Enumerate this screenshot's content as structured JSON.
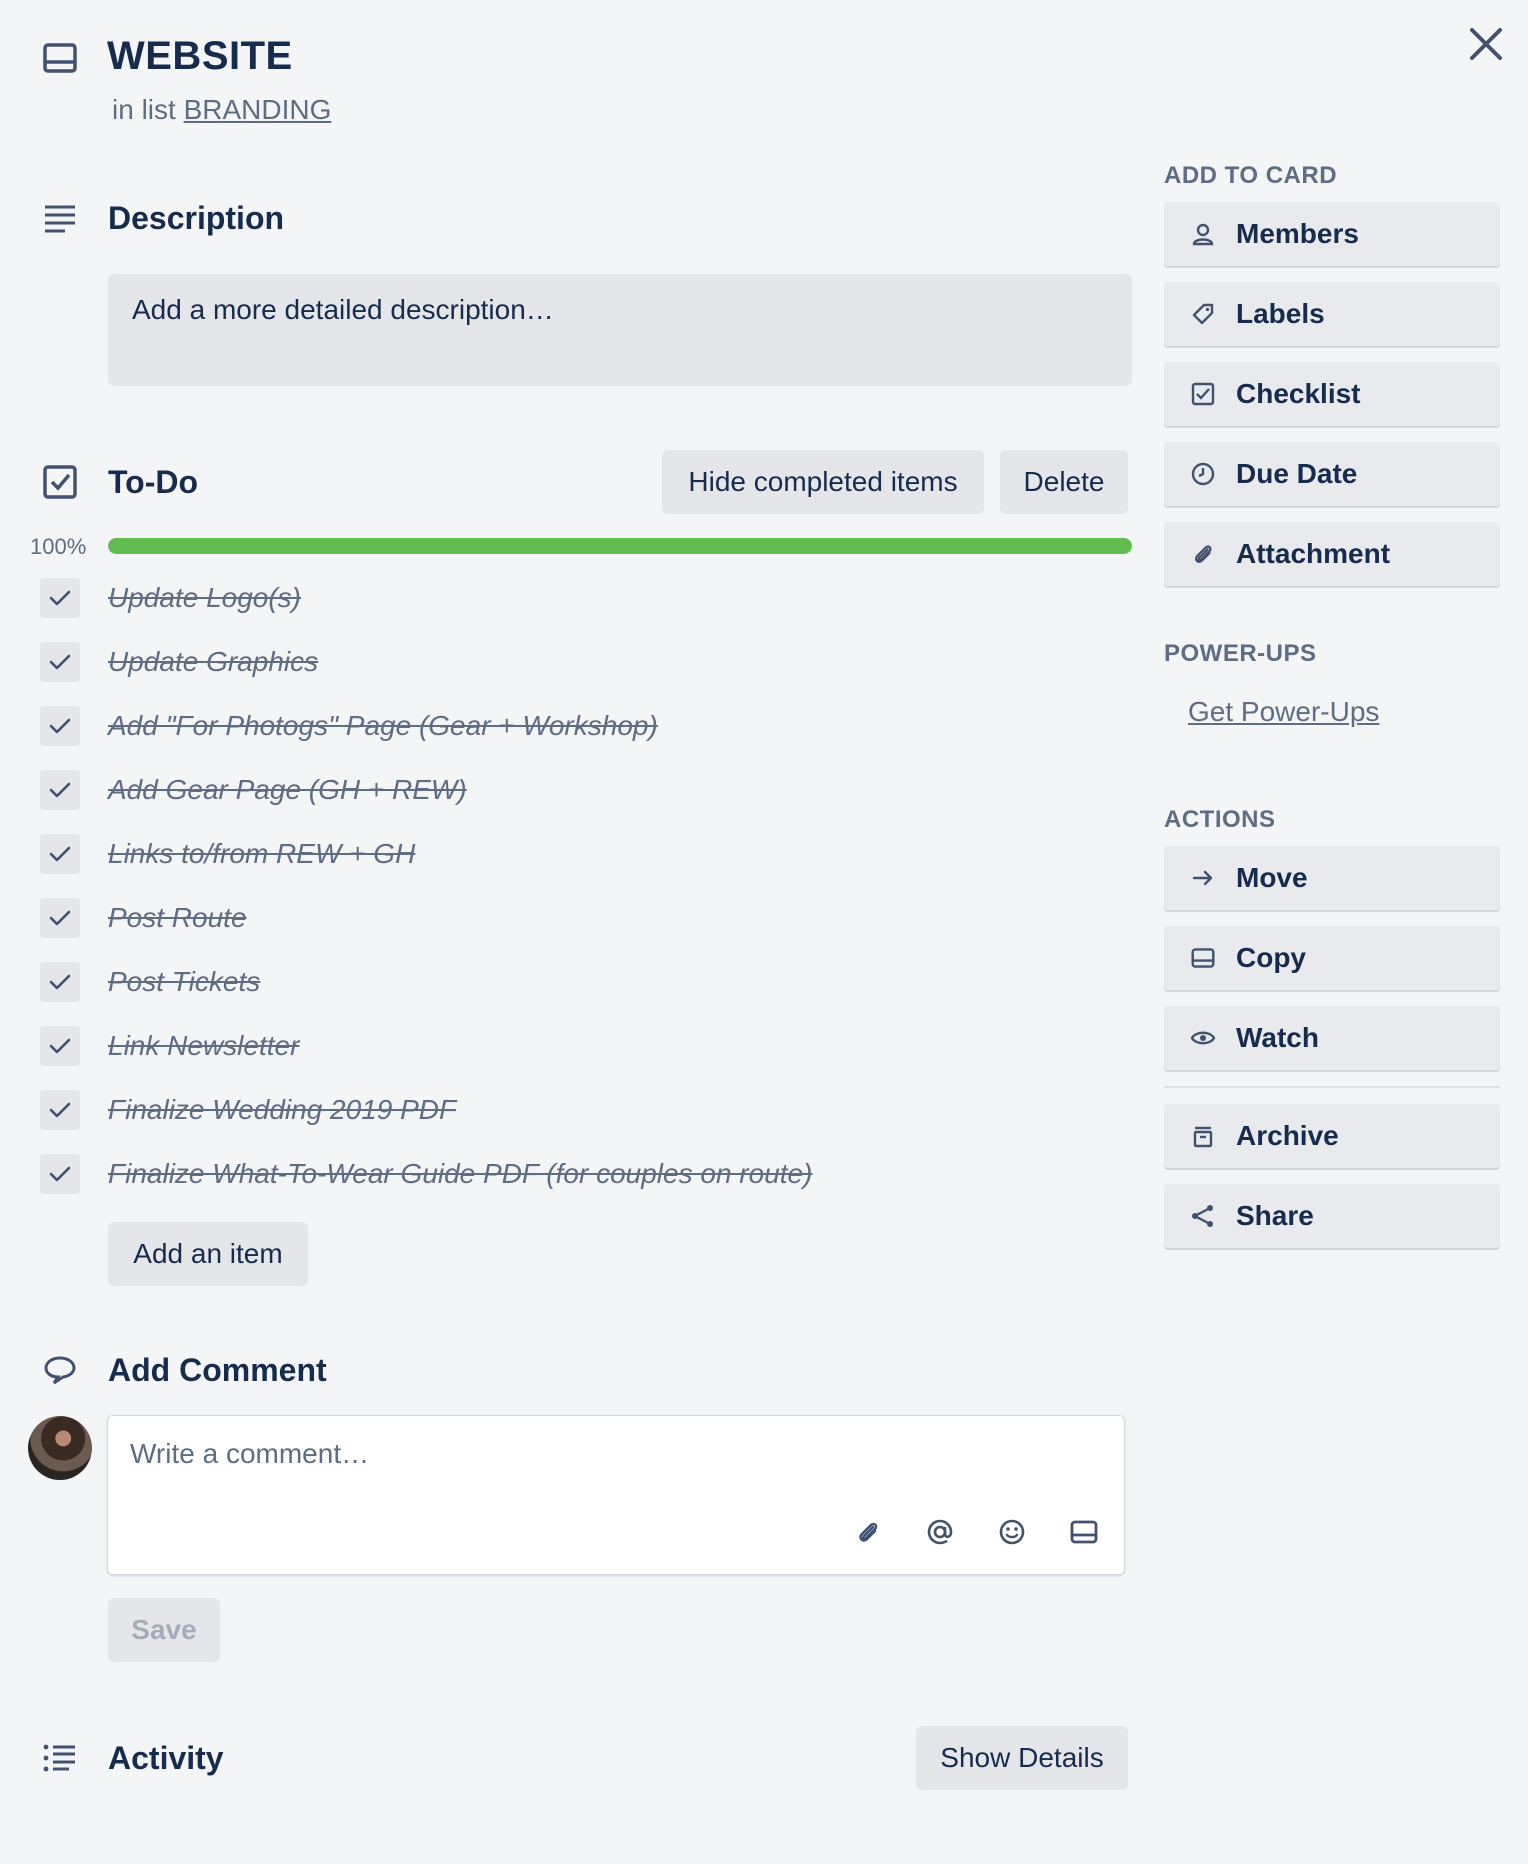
{
  "card": {
    "title": "WEBSITE",
    "in_list_prefix": "in list",
    "list_name": "BRANDING"
  },
  "description": {
    "title": "Description",
    "placeholder": "Add a more detailed description…"
  },
  "checklist": {
    "title": "To-Do",
    "hide_completed_label": "Hide completed items",
    "delete_label": "Delete",
    "progress_label": "100%",
    "progress_fraction": 1.0,
    "items": [
      {
        "text": "Update Logo(s)",
        "checked": true
      },
      {
        "text": "Update Graphics",
        "checked": true
      },
      {
        "text": "Add \"For Photogs\" Page (Gear + Workshop)",
        "checked": true
      },
      {
        "text": "Add Gear Page (GH + REW)",
        "checked": true
      },
      {
        "text": "Links to/from REW + GH",
        "checked": true
      },
      {
        "text": "Post Route",
        "checked": true
      },
      {
        "text": "Post Tickets",
        "checked": true
      },
      {
        "text": "Link Newsletter",
        "checked": true
      },
      {
        "text": "Finalize Wedding 2019 PDF",
        "checked": true
      },
      {
        "text": "Finalize What-To-Wear Guide PDF (for couples on route)",
        "checked": true
      }
    ],
    "add_item_label": "Add an item"
  },
  "comment": {
    "title": "Add Comment",
    "placeholder": "Write a comment…",
    "save_label": "Save",
    "tools": [
      "attachment-icon",
      "mention-icon",
      "emoji-icon",
      "card-icon"
    ]
  },
  "activity": {
    "title": "Activity",
    "show_details_label": "Show Details"
  },
  "sidebar": {
    "add_to_card_heading": "ADD TO CARD",
    "add_to_card": [
      {
        "label": "Members",
        "icon": "member-icon"
      },
      {
        "label": "Labels",
        "icon": "label-icon"
      },
      {
        "label": "Checklist",
        "icon": "checklist-icon"
      },
      {
        "label": "Due Date",
        "icon": "clock-icon"
      },
      {
        "label": "Attachment",
        "icon": "attachment-icon"
      }
    ],
    "power_ups_heading": "POWER-UPS",
    "get_power_ups_label": "Get Power-Ups",
    "actions_heading": "ACTIONS",
    "actions": [
      {
        "label": "Move",
        "icon": "arrow-right-icon"
      },
      {
        "label": "Copy",
        "icon": "card-icon"
      },
      {
        "label": "Watch",
        "icon": "eye-icon"
      }
    ],
    "actions_secondary": [
      {
        "label": "Archive",
        "icon": "archive-icon"
      },
      {
        "label": "Share",
        "icon": "share-icon"
      }
    ]
  },
  "colors": {
    "background": "#f4f5f7",
    "text": "#172b4d",
    "muted": "#5e6c84",
    "progress": "#61bd4f",
    "button": "#e4e6ea"
  }
}
